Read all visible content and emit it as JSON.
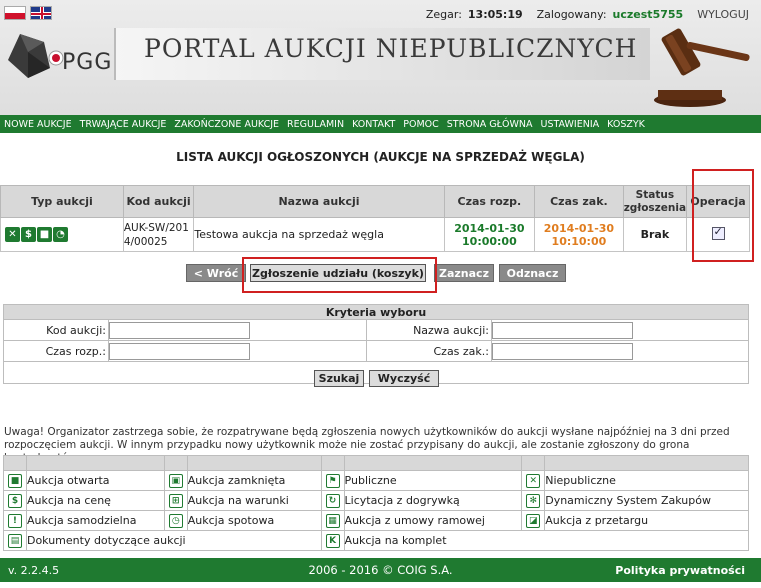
{
  "header": {
    "clock_label": "Zegar:",
    "clock_value": "13:05:19",
    "logged_label": "Zalogowany:",
    "username": "uczest5755",
    "logout": "WYLOGUJ",
    "logo_text": "PGG",
    "portal_title": "PORTAL AUKCJI NIEPUBLICZNYCH"
  },
  "nav": [
    "NOWE AUKCJE",
    "TRWAJĄCE AUKCJE",
    "ZAKOŃCZONE AUKCJE",
    "REGULAMIN",
    "KONTAKT",
    "POMOC",
    "STRONA GŁÓWNA",
    "USTAWIENIA",
    "KOSZYK"
  ],
  "list_title": "LISTA AUKCJI OGŁOSZONYCH (AUKCJE NA SPRZEDAŻ WĘGLA)",
  "table": {
    "headers": [
      "Typ aukcji",
      "Kod aukcji",
      "Nazwa aukcji",
      "Czas rozp.",
      "Czas zak.",
      "Status zgłoszenia",
      "Operacja"
    ],
    "row": {
      "code": "AUK-SW/2014/00025",
      "name": "Testowa aukcja na sprzedaż węgla",
      "start_date": "2014-01-30",
      "start_time": "10:00:00",
      "end_date": "2014-01-30",
      "end_time": "10:10:00",
      "status": "Brak"
    }
  },
  "buttons": {
    "back": "< Wróć",
    "submit": "Zgłoszenie udziału (koszyk)",
    "select_all": "Zaznacz",
    "deselect_all": "Odznacz",
    "search": "Szukaj",
    "clear": "Wyczyść"
  },
  "criteria": {
    "title": "Kryteria wyboru",
    "code_label": "Kod aukcji:",
    "name_label": "Nazwa aukcji:",
    "start_label": "Czas rozp.:",
    "end_label": "Czas zak.:"
  },
  "warning": "Uwaga! Organizator zastrzega sobie, że rozpatrywane będą zgłoszenia nowych użytkowników do aukcji wysłane najpóźniej na 3 dni przed rozpoczęciem aukcji. W innym przypadku nowy użytkownik może nie zostać przypisany do aukcji, ale zostanie zgłoszony do grona kontrahentów.",
  "legend": {
    "r1": [
      "Aukcja otwarta",
      "Aukcja zamknięta",
      "Publiczne",
      "Niepubliczne"
    ],
    "r2": [
      "Aukcja na cenę",
      "Aukcja na warunki",
      "Licytacja z dogrywką",
      "Dynamiczny System Zakupów"
    ],
    "r3": [
      "Aukcja samodzielna",
      "Aukcja spotowa",
      "Aukcja z umowy ramowej",
      "Aukcja z przetargu"
    ],
    "r4": [
      "Dokumenty dotyczące aukcji",
      "Aukcja na komplet"
    ]
  },
  "footer": {
    "version": "v. 2.2.4.5",
    "copyright": "2006 - 2016 © COIG S.A.",
    "privacy": "Polityka prywatności"
  },
  "colors": {
    "green": "#1f7a30",
    "orange": "#e07d1f",
    "red_highlight": "#d02020"
  }
}
